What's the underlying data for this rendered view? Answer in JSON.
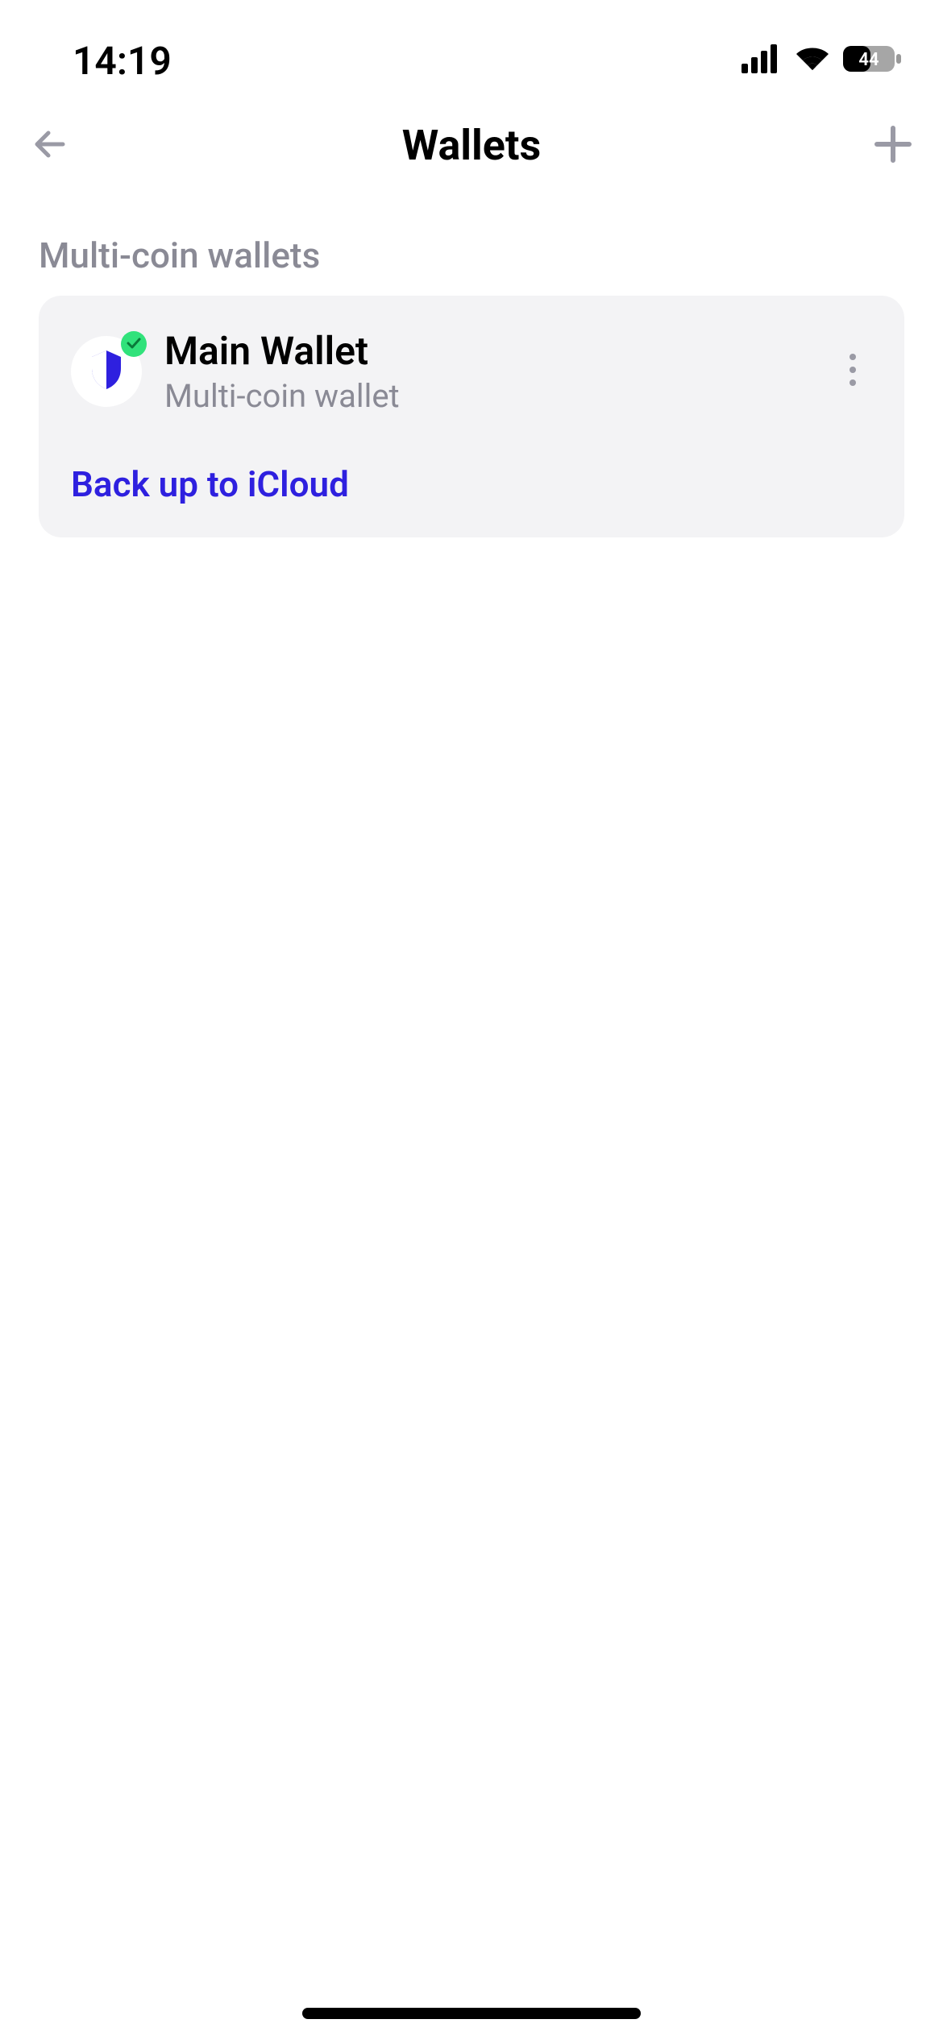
{
  "status": {
    "time": "14:19",
    "battery": "44"
  },
  "nav": {
    "title": "Wallets"
  },
  "section": {
    "header": "Multi-coin wallets"
  },
  "wallets": [
    {
      "name": "Main Wallet",
      "subtitle": "Multi-coin wallet",
      "action": "Back up to iCloud"
    }
  ]
}
